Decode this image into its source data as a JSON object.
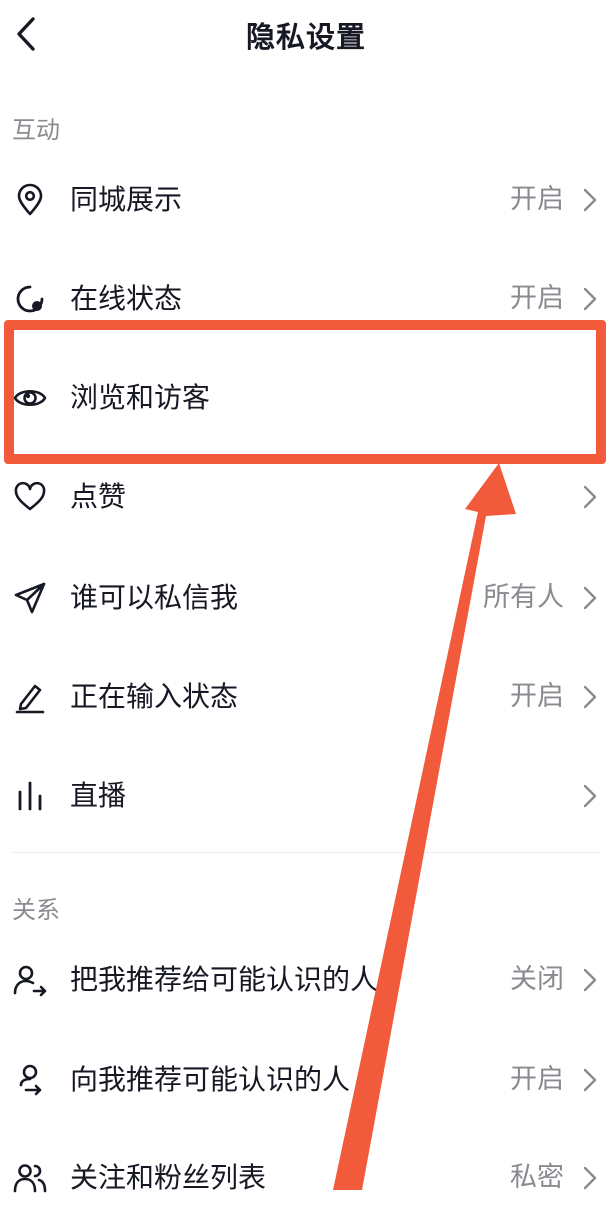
{
  "header": {
    "title": "隐私设置",
    "back_icon": "chevron-left-icon"
  },
  "sections": [
    {
      "title": "互动",
      "items": [
        {
          "label": "同城展示",
          "value": "开启",
          "icon": "location-pin-icon"
        },
        {
          "label": "在线状态",
          "value": "开启",
          "icon": "online-status-icon"
        },
        {
          "label": "浏览和访客",
          "value": "",
          "icon": "eye-icon"
        },
        {
          "label": "点赞",
          "value": "",
          "icon": "heart-icon"
        },
        {
          "label": "谁可以私信我",
          "value": "所有人",
          "icon": "paper-plane-icon"
        },
        {
          "label": "正在输入状态",
          "value": "开启",
          "icon": "pencil-icon"
        },
        {
          "label": "直播",
          "value": "",
          "icon": "live-bars-icon"
        }
      ]
    },
    {
      "title": "关系",
      "items": [
        {
          "label": "把我推荐给可能认识的人",
          "value": "关闭",
          "icon": "user-share-icon"
        },
        {
          "label": "向我推荐可能认识的人",
          "value": "开启",
          "icon": "user-recommend-icon"
        },
        {
          "label": "关注和粉丝列表",
          "value": "私密",
          "icon": "users-icon"
        }
      ]
    }
  ],
  "colors": {
    "annotation": "#f25a3c",
    "text": "#161823",
    "muted": "#8a8b91"
  }
}
